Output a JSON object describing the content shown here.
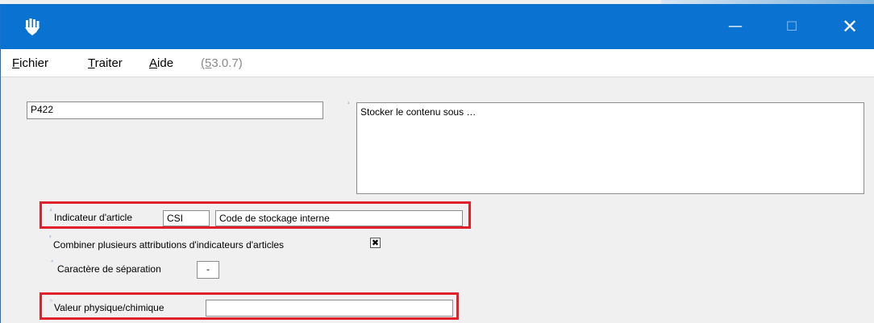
{
  "window": {
    "controls": {
      "minimize": "—",
      "maximize": "☐",
      "close": "✕"
    }
  },
  "menu": {
    "items": [
      "Fichier",
      "Traiter",
      "Aide"
    ],
    "version": "(53.0.7)"
  },
  "form": {
    "code_value": "P422",
    "description_marker": "¹",
    "description_value": "Stocker le contenu sous …",
    "article_indicator": {
      "marker": "²",
      "label": "Indicateur d'article",
      "code": "CSI",
      "description": "Code de stockage interne"
    },
    "combine": {
      "marker": "³",
      "label": "Combiner plusieurs attributions d'indicateurs d'articles",
      "checked": true,
      "check_glyph": "✖"
    },
    "separator": {
      "marker": "⁴",
      "label": "Caractère de séparation",
      "value": "-"
    },
    "physical_value": {
      "marker": "⁵",
      "label": "Valeur physique/chimique",
      "value": ""
    }
  },
  "colors": {
    "titlebar": "#0a72d1",
    "highlight": "#e0202a",
    "background": "#f0f0f0"
  }
}
